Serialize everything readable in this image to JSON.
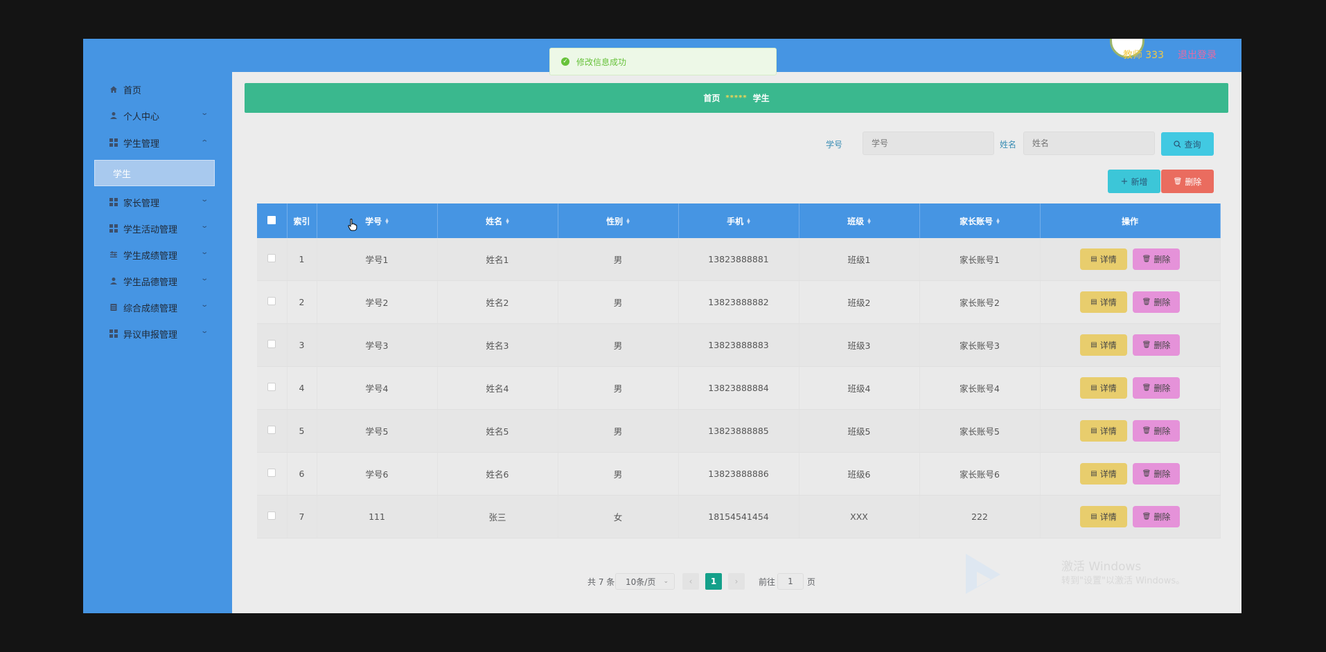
{
  "header": {
    "user": "教师 333",
    "logout": "退出登录"
  },
  "toast": {
    "message": "修改信息成功"
  },
  "sidebar": {
    "items": [
      {
        "label": "首页",
        "icon": "home-icon"
      },
      {
        "label": "个人中心",
        "icon": "user-icon"
      },
      {
        "label": "学生管理",
        "icon": "grid-icon"
      },
      {
        "label": "家长管理",
        "icon": "grid-icon"
      },
      {
        "label": "学生活动管理",
        "icon": "grid-icon"
      },
      {
        "label": "学生成绩管理",
        "icon": "sliders-icon"
      },
      {
        "label": "学生品德管理",
        "icon": "user-icon"
      },
      {
        "label": "综合成绩管理",
        "icon": "list-icon"
      },
      {
        "label": "异议申报管理",
        "icon": "grid-icon"
      }
    ],
    "active_sub": "学生"
  },
  "breadcrumb": {
    "home": "首页",
    "separator": "*****",
    "current": "学生"
  },
  "search": {
    "id_label": "学号",
    "id_placeholder": "学号",
    "name_label": "姓名",
    "name_placeholder": "姓名",
    "query_button": "查询"
  },
  "actions": {
    "add": "新增",
    "delete": "删除"
  },
  "table": {
    "headers": [
      "索引",
      "学号",
      "姓名",
      "性别",
      "手机",
      "班级",
      "家长账号",
      "操作"
    ],
    "rows": [
      {
        "index": "1",
        "id": "学号1",
        "name": "姓名1",
        "gender": "男",
        "phone": "13823888881",
        "class": "班级1",
        "parent": "家长账号1"
      },
      {
        "index": "2",
        "id": "学号2",
        "name": "姓名2",
        "gender": "男",
        "phone": "13823888882",
        "class": "班级2",
        "parent": "家长账号2"
      },
      {
        "index": "3",
        "id": "学号3",
        "name": "姓名3",
        "gender": "男",
        "phone": "13823888883",
        "class": "班级3",
        "parent": "家长账号3"
      },
      {
        "index": "4",
        "id": "学号4",
        "name": "姓名4",
        "gender": "男",
        "phone": "13823888884",
        "class": "班级4",
        "parent": "家长账号4"
      },
      {
        "index": "5",
        "id": "学号5",
        "name": "姓名5",
        "gender": "男",
        "phone": "13823888885",
        "class": "班级5",
        "parent": "家长账号5"
      },
      {
        "index": "6",
        "id": "学号6",
        "name": "姓名6",
        "gender": "男",
        "phone": "13823888886",
        "class": "班级6",
        "parent": "家长账号6"
      },
      {
        "index": "7",
        "id": "111",
        "name": "张三",
        "gender": "女",
        "phone": "18154541454",
        "class": "XXX",
        "parent": "222"
      }
    ],
    "row_actions": {
      "detail": "详情",
      "delete": "删除"
    }
  },
  "pagination": {
    "total": "共 7 条",
    "page_size": "10条/页",
    "current_page": "1",
    "goto_prefix": "前往",
    "goto_value": "1",
    "goto_suffix": "页"
  },
  "watermark": {
    "line1": "激活 Windows",
    "line2": "转到\"设置\"以激活 Windows。"
  },
  "colors": {
    "topbar": "#4695e3",
    "breadcrumb_bg": "#3ab88e",
    "query_btn": "#41c9e2",
    "add_btn": "#3cc6d8",
    "delete_btn": "#ea6c5f",
    "detail_btn": "#e8cd6d",
    "row_delete_btn": "#e592d9",
    "page_active": "#14a08a"
  }
}
